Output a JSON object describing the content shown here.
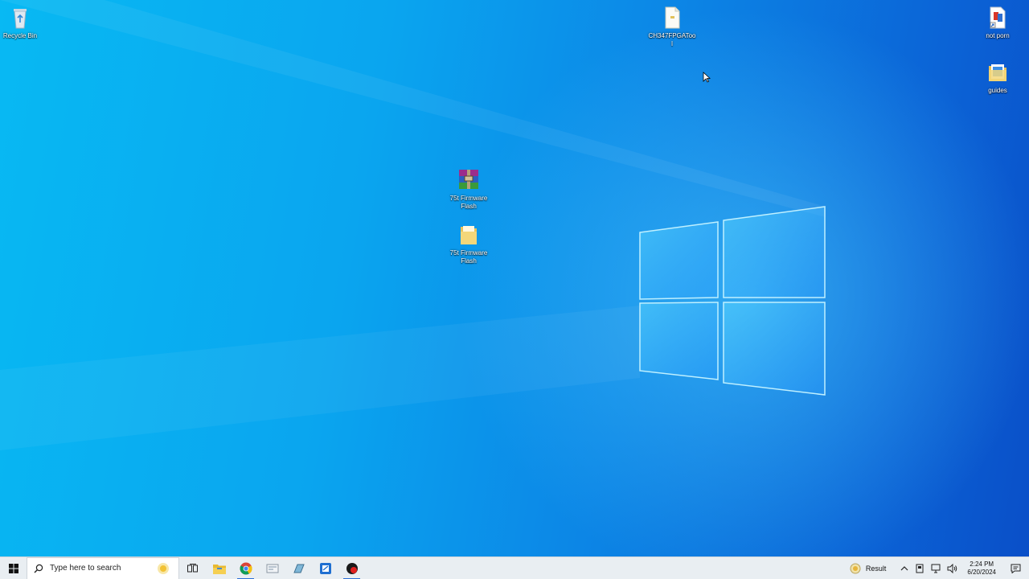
{
  "desktop": {
    "icons": [
      {
        "label": "Recycle Bin",
        "icon": "recycle-bin-icon"
      },
      {
        "label": "CH347FPGATool",
        "icon": "file-icon"
      },
      {
        "label": "not porn",
        "icon": "shortcut-file-icon"
      },
      {
        "label": "guides",
        "icon": "folder-icon"
      },
      {
        "label": "75t Firmware Flash",
        "icon": "winrar-archive-icon"
      },
      {
        "label": "75t Firmware Flash",
        "icon": "folder-icon"
      }
    ]
  },
  "taskbar": {
    "search_placeholder": "Type here to search",
    "pinned": [
      "task-view-icon",
      "file-explorer-icon",
      "chrome-icon",
      "app-icon",
      "app-icon",
      "app-icon",
      "app-icon"
    ],
    "tray": {
      "result_label": "Result",
      "time": "2:24 PM",
      "date": "6/20/2024"
    }
  },
  "colors": {
    "wallpaper_light": "#08b9f3",
    "wallpaper_dark": "#0a4fc8",
    "taskbar_bg": "#e9eef2",
    "accent": "#2b6fd6"
  }
}
